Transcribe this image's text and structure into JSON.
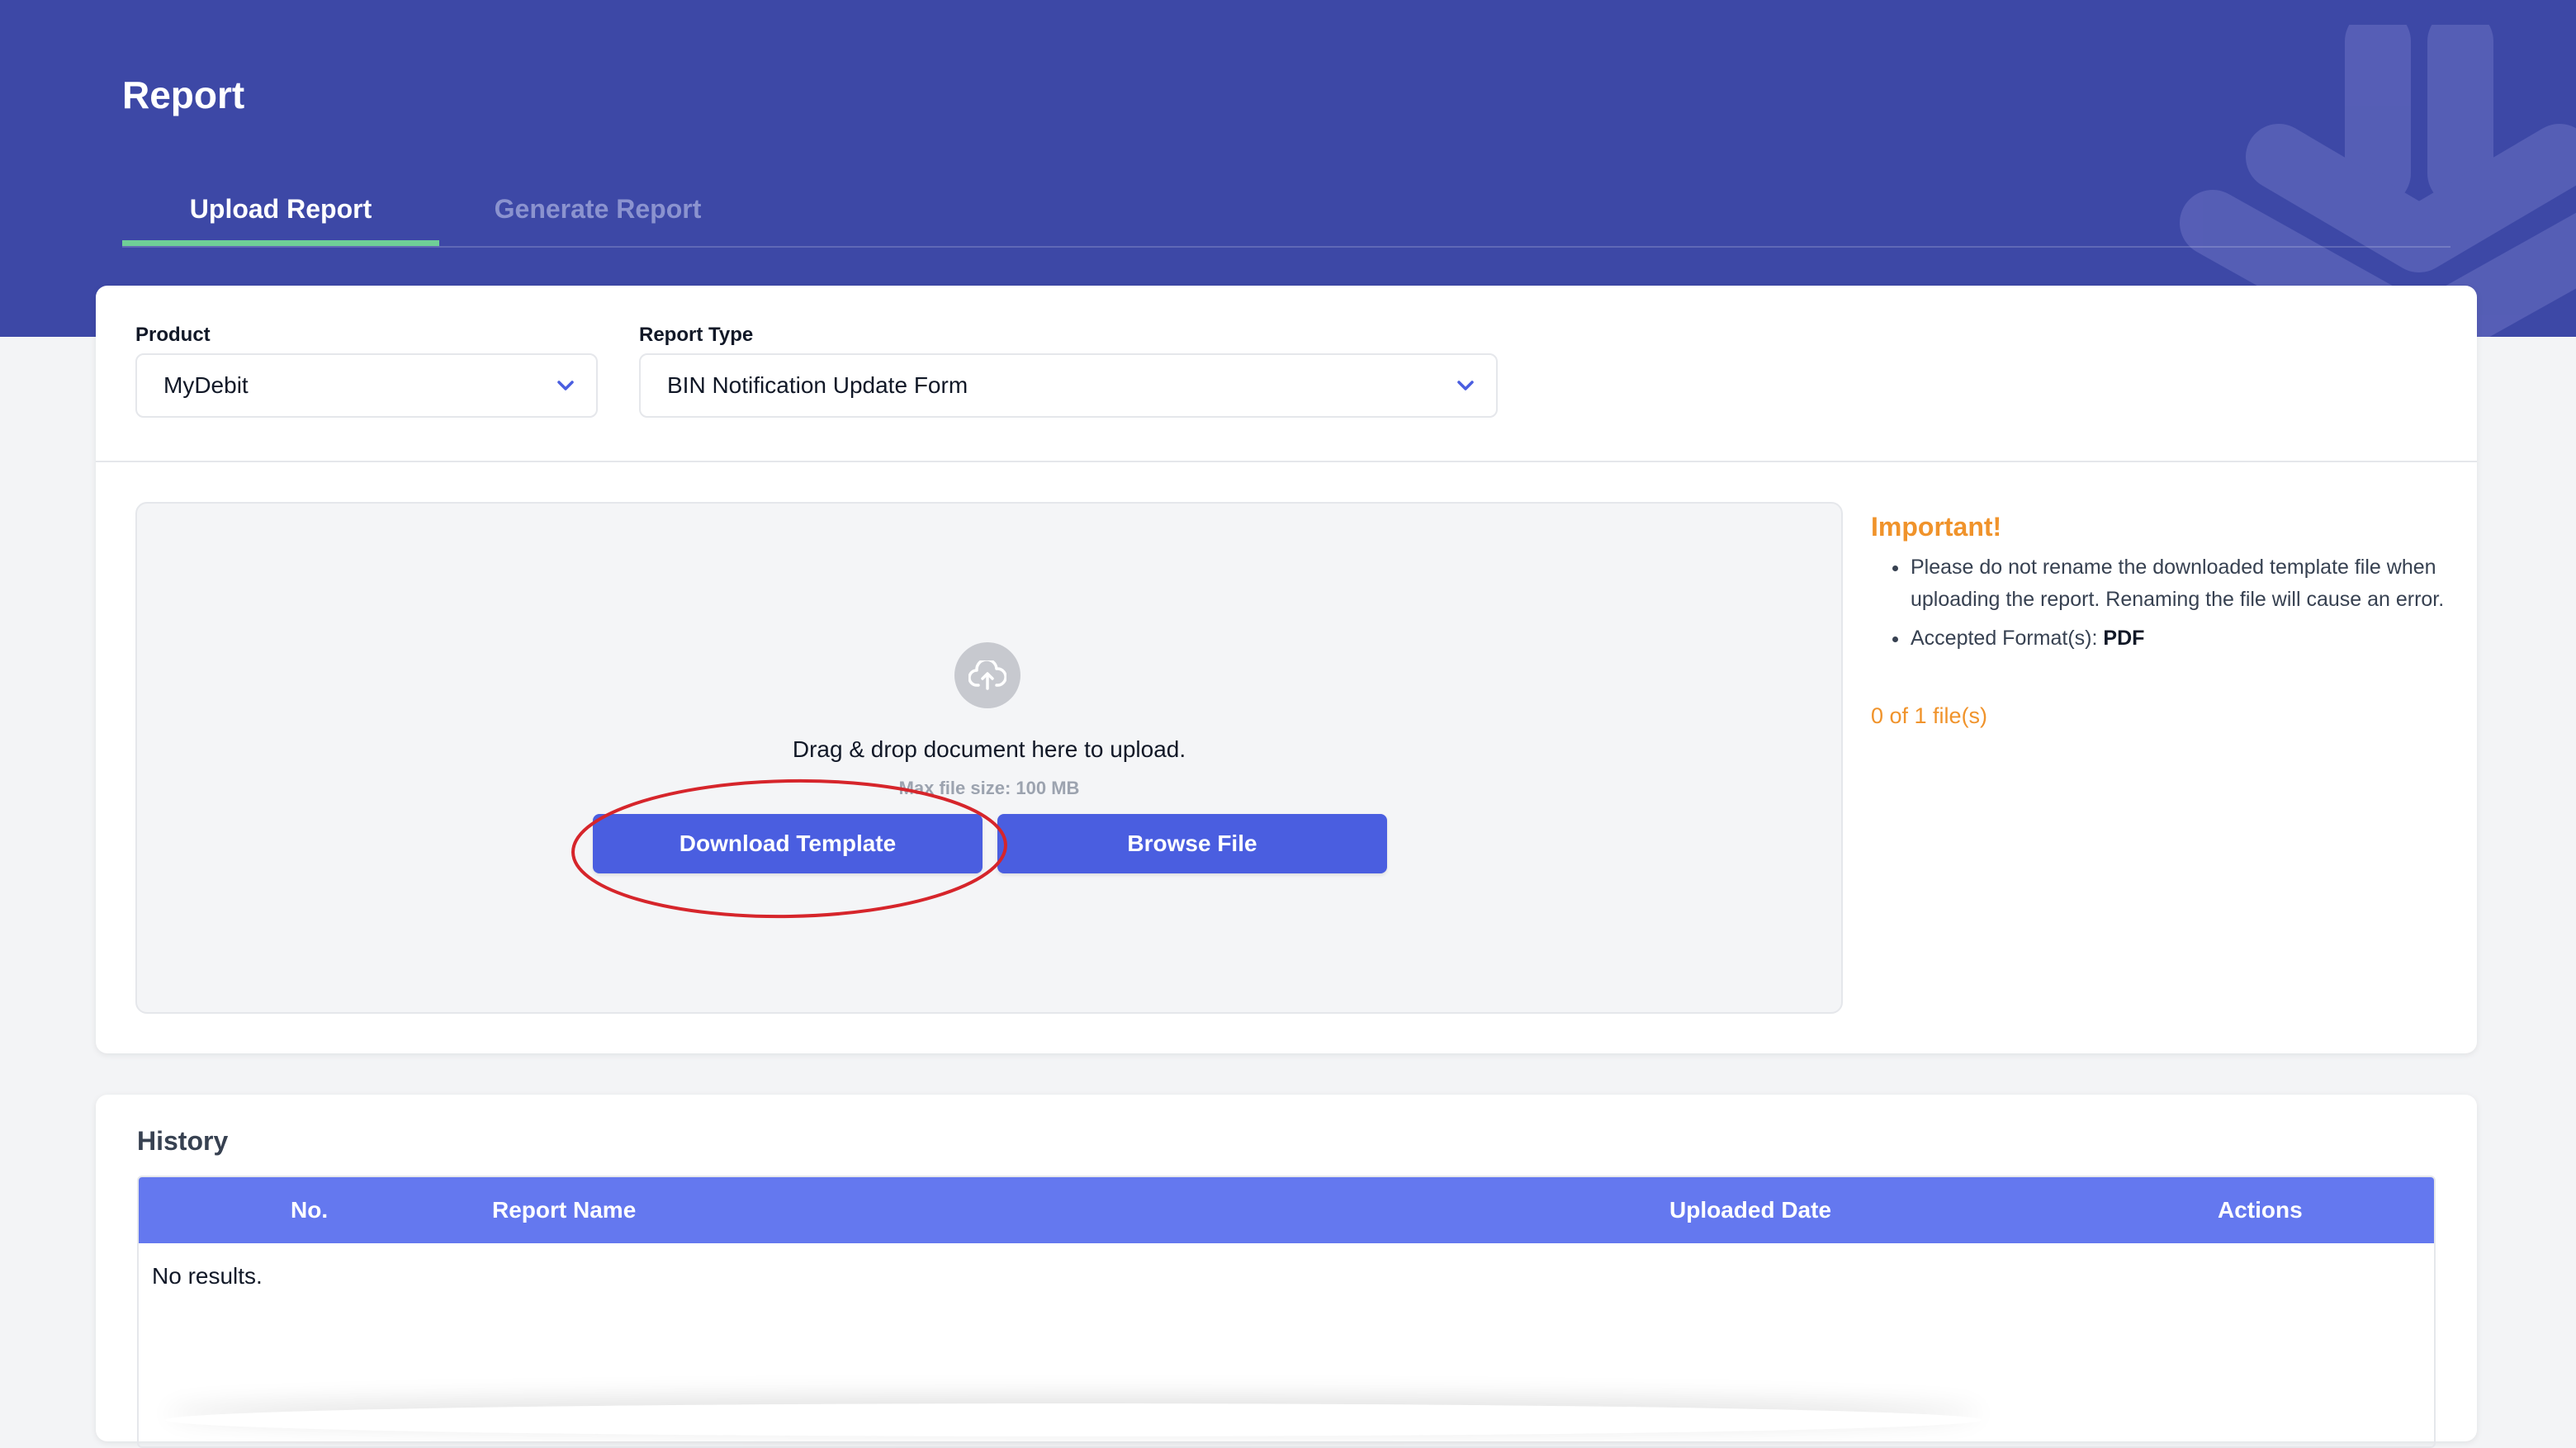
{
  "header": {
    "title": "Report",
    "tabs": [
      {
        "label": "Upload Report",
        "active": true
      },
      {
        "label": "Generate Report",
        "active": false
      }
    ]
  },
  "filters": {
    "product": {
      "label": "Product",
      "value": "MyDebit"
    },
    "report_type": {
      "label": "Report Type",
      "value": "BIN Notification Update Form"
    }
  },
  "upload": {
    "drop_text": "Drag & drop document here to upload.",
    "max_size_text": "Max file size: 100 MB",
    "download_label": "Download Template",
    "browse_label": "Browse File"
  },
  "important": {
    "title": "Important!",
    "notes": [
      "Please do not rename the downloaded template file when uploading the report. Renaming the file will cause an error."
    ],
    "format_label": "Accepted Format(s): ",
    "format_value": "PDF",
    "file_count": "0 of 1 file(s)"
  },
  "history": {
    "title": "History",
    "columns": [
      "No.",
      "Report Name",
      "Uploaded Date",
      "Actions"
    ],
    "rows": [],
    "empty_text": "No results."
  },
  "colors": {
    "header_bg": "#3d48a6",
    "tab_indicator": "#6fcf97",
    "primary_button": "#4a5ee0",
    "table_header": "#6478ef",
    "important": "#f0932b",
    "annotation": "#d6252b"
  }
}
